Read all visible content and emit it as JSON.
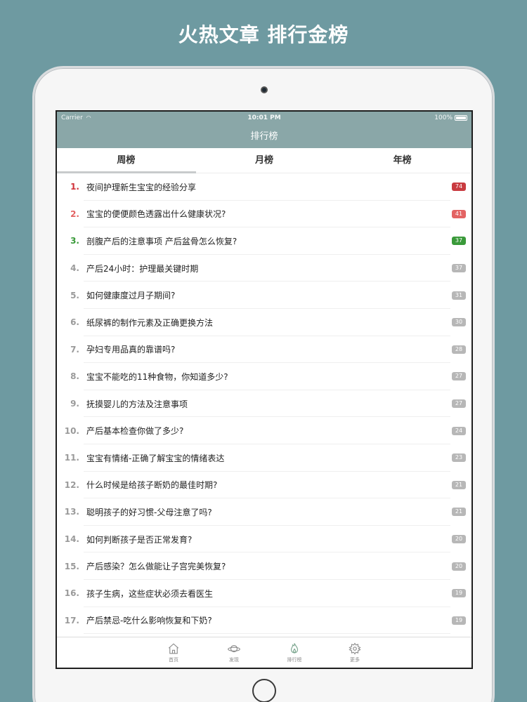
{
  "headline": "火热文章 排行金榜",
  "status": {
    "carrier": "Carrier",
    "time": "10:01 PM",
    "battery": "100%"
  },
  "nav": {
    "title": "排行榜"
  },
  "tabs": [
    {
      "label": "周榜"
    },
    {
      "label": "月榜"
    },
    {
      "label": "年榜"
    }
  ],
  "colors": {
    "top1": "#d0323a",
    "top2": "#e36363",
    "top3": "#3a9a3a",
    "default_rank": "#9a9a9a",
    "default_badge": "#b7b7b7"
  },
  "articles": [
    {
      "rank": "1.",
      "title": "夜间护理新生宝宝的经验分享",
      "count": "74",
      "rank_color": "#d0323a",
      "badge_color": "#c93b40"
    },
    {
      "rank": "2.",
      "title": "宝宝的便便颜色透露出什么健康状况?",
      "count": "41",
      "rank_color": "#e36363",
      "badge_color": "#e36363"
    },
    {
      "rank": "3.",
      "title": "剖腹产后的注意事项 产后盆骨怎么恢复?",
      "count": "37",
      "rank_color": "#3a9a3a",
      "badge_color": "#3a9a3a"
    },
    {
      "rank": "4.",
      "title": "产后24小时：护理最关键时期",
      "count": "37",
      "rank_color": "#9a9a9a",
      "badge_color": "#b7b7b7"
    },
    {
      "rank": "5.",
      "title": "如何健康度过月子期间?",
      "count": "31",
      "rank_color": "#9a9a9a",
      "badge_color": "#b7b7b7"
    },
    {
      "rank": "6.",
      "title": "纸尿裤的制作元素及正确更换方法",
      "count": "30",
      "rank_color": "#9a9a9a",
      "badge_color": "#b7b7b7"
    },
    {
      "rank": "7.",
      "title": "孕妇专用品真的靠谱吗?",
      "count": "28",
      "rank_color": "#9a9a9a",
      "badge_color": "#b7b7b7"
    },
    {
      "rank": "8.",
      "title": "宝宝不能吃的11种食物，你知道多少?",
      "count": "27",
      "rank_color": "#9a9a9a",
      "badge_color": "#b7b7b7"
    },
    {
      "rank": "9.",
      "title": "抚摸婴儿的方法及注意事项",
      "count": "27",
      "rank_color": "#9a9a9a",
      "badge_color": "#b7b7b7"
    },
    {
      "rank": "10.",
      "title": "产后基本检查你做了多少?",
      "count": "24",
      "rank_color": "#9a9a9a",
      "badge_color": "#b7b7b7"
    },
    {
      "rank": "11.",
      "title": "宝宝有情绪-正确了解宝宝的情绪表达",
      "count": "23",
      "rank_color": "#9a9a9a",
      "badge_color": "#b7b7b7"
    },
    {
      "rank": "12.",
      "title": "什么时候是给孩子断奶的最佳时期?",
      "count": "21",
      "rank_color": "#9a9a9a",
      "badge_color": "#b7b7b7"
    },
    {
      "rank": "13.",
      "title": "聪明孩子的好习惯-父母注意了吗?",
      "count": "21",
      "rank_color": "#9a9a9a",
      "badge_color": "#b7b7b7"
    },
    {
      "rank": "14.",
      "title": "如何判断孩子是否正常发育?",
      "count": "20",
      "rank_color": "#9a9a9a",
      "badge_color": "#b7b7b7"
    },
    {
      "rank": "15.",
      "title": "产后感染？怎么做能让子宫完美恢复?",
      "count": "20",
      "rank_color": "#9a9a9a",
      "badge_color": "#b7b7b7"
    },
    {
      "rank": "16.",
      "title": "孩子生病，这些症状必须去看医生",
      "count": "19",
      "rank_color": "#9a9a9a",
      "badge_color": "#b7b7b7"
    },
    {
      "rank": "17.",
      "title": "产后禁忌-吃什么影响恢复和下奶?",
      "count": "19",
      "rank_color": "#9a9a9a",
      "badge_color": "#b7b7b7"
    }
  ],
  "tabbar": [
    {
      "label": "首页",
      "icon": "home-icon"
    },
    {
      "label": "发现",
      "icon": "planet-icon"
    },
    {
      "label": "排行榜",
      "icon": "flame-icon"
    },
    {
      "label": "更多",
      "icon": "gear-icon"
    }
  ]
}
